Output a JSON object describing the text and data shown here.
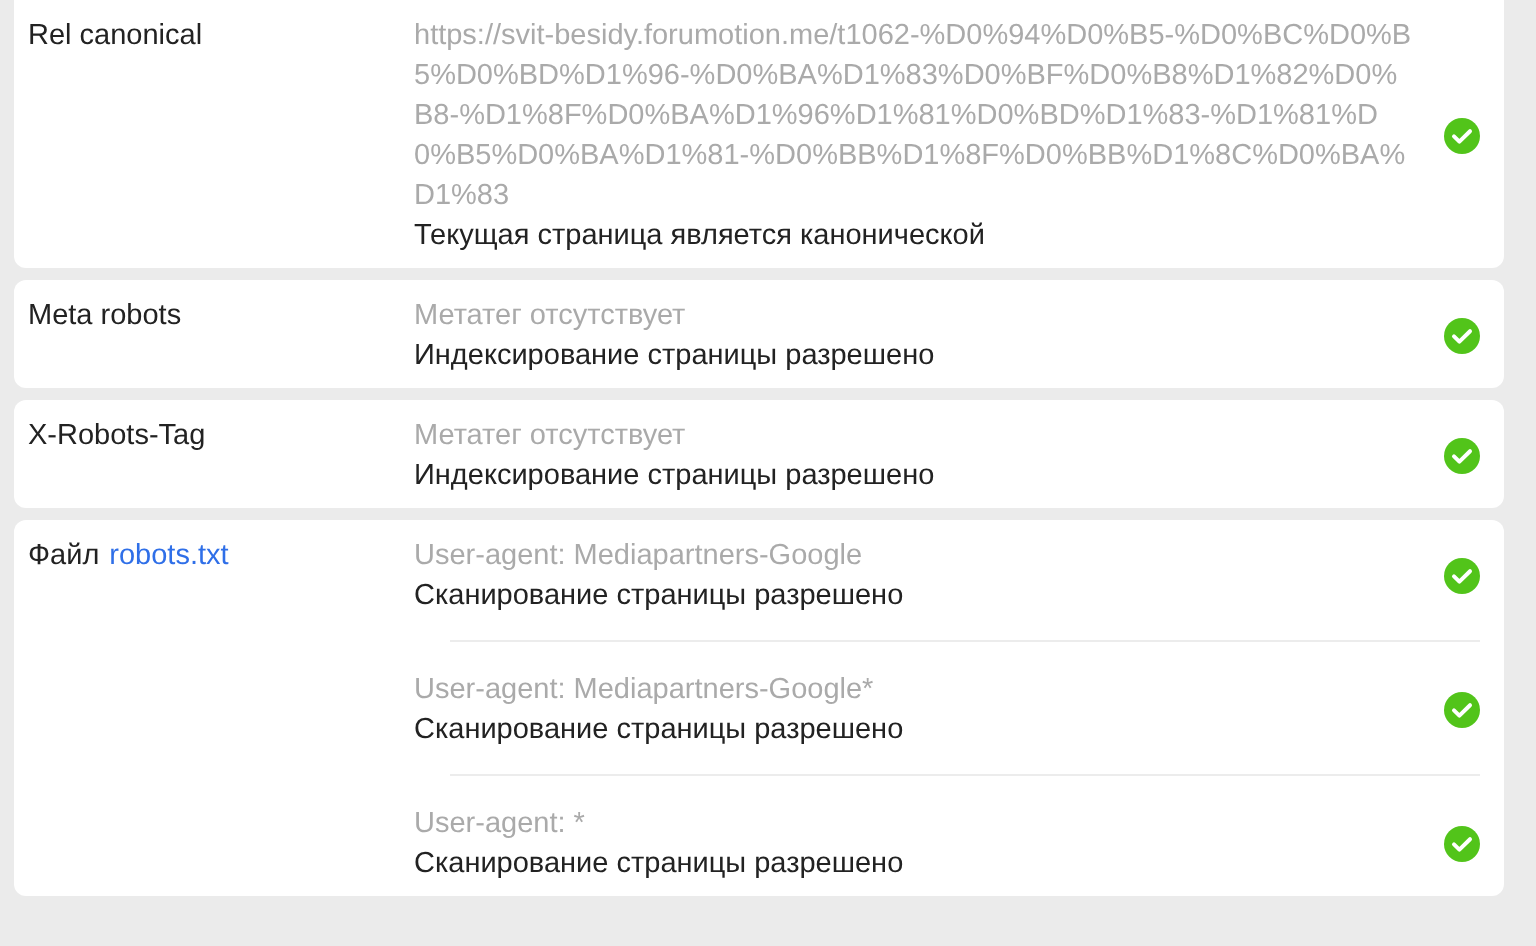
{
  "rows": [
    {
      "label": "Rel canonical",
      "entries": [
        {
          "hint": "https://svit-besidy.forumotion.me/t1062-%D0%94%D0%B5-%D0%BC%D0%B5%D0%BD%D1%96-%D0%BA%D1%83%D0%BF%D0%B8%D1%82%D0%B8-%D1%8F%D0%BA%D1%96%D1%81%D0%BD%D1%83-%D1%81%D0%B5%D0%BA%D1%81-%D0%BB%D1%8F%D0%BB%D1%8C%D0%BA%D1%83",
          "result": "Текущая страница является канонической",
          "passed": true
        }
      ]
    },
    {
      "label": "Meta robots",
      "entries": [
        {
          "hint": "Метатег отсутствует",
          "result": "Индексирование страницы разрешено",
          "passed": true
        }
      ]
    },
    {
      "label": "X-Robots-Tag",
      "entries": [
        {
          "hint": "Метатег отсутствует",
          "result": "Индексирование страницы разрешено",
          "passed": true
        }
      ]
    },
    {
      "label": "Файл",
      "link": "robots.txt",
      "entries": [
        {
          "hint": "User-agent: Mediapartners-Google",
          "result": "Сканирование страницы разрешено",
          "passed": true
        },
        {
          "hint": "User-agent: Mediapartners-Google*",
          "result": "Сканирование страницы разрешено",
          "passed": true
        },
        {
          "hint": "User-agent: *",
          "result": "Сканирование страницы разрешено",
          "passed": true
        }
      ]
    }
  ]
}
